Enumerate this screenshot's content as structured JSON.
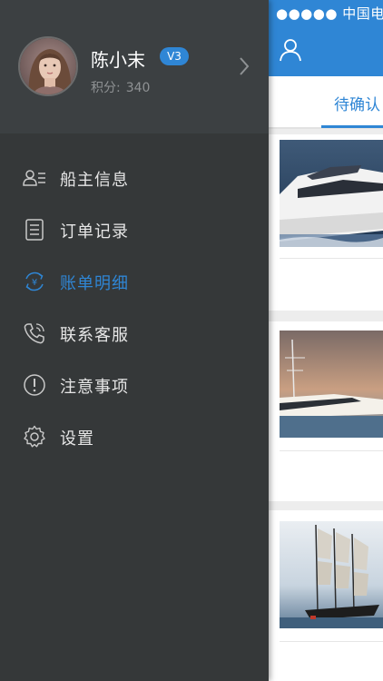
{
  "status_bar": {
    "carrier": "●●●●● 中国电信"
  },
  "main": {
    "active_tab": "待确认",
    "card_count": 3
  },
  "profile": {
    "name": "陈小末",
    "level": "V3",
    "points_label": "积分:",
    "points_value": "340"
  },
  "menu": {
    "items": [
      {
        "label": "船主信息",
        "icon": "owner-info-icon"
      },
      {
        "label": "订单记录",
        "icon": "order-record-icon"
      },
      {
        "label": "账单明细",
        "icon": "bill-detail-icon",
        "active": true
      },
      {
        "label": "联系客服",
        "icon": "phone-icon"
      },
      {
        "label": "注意事项",
        "icon": "notice-icon"
      },
      {
        "label": "设置",
        "icon": "settings-icon"
      }
    ]
  },
  "colors": {
    "accent": "#2f86d5",
    "drawer_bg": "#353839",
    "profile_bg": "#3c4042"
  }
}
